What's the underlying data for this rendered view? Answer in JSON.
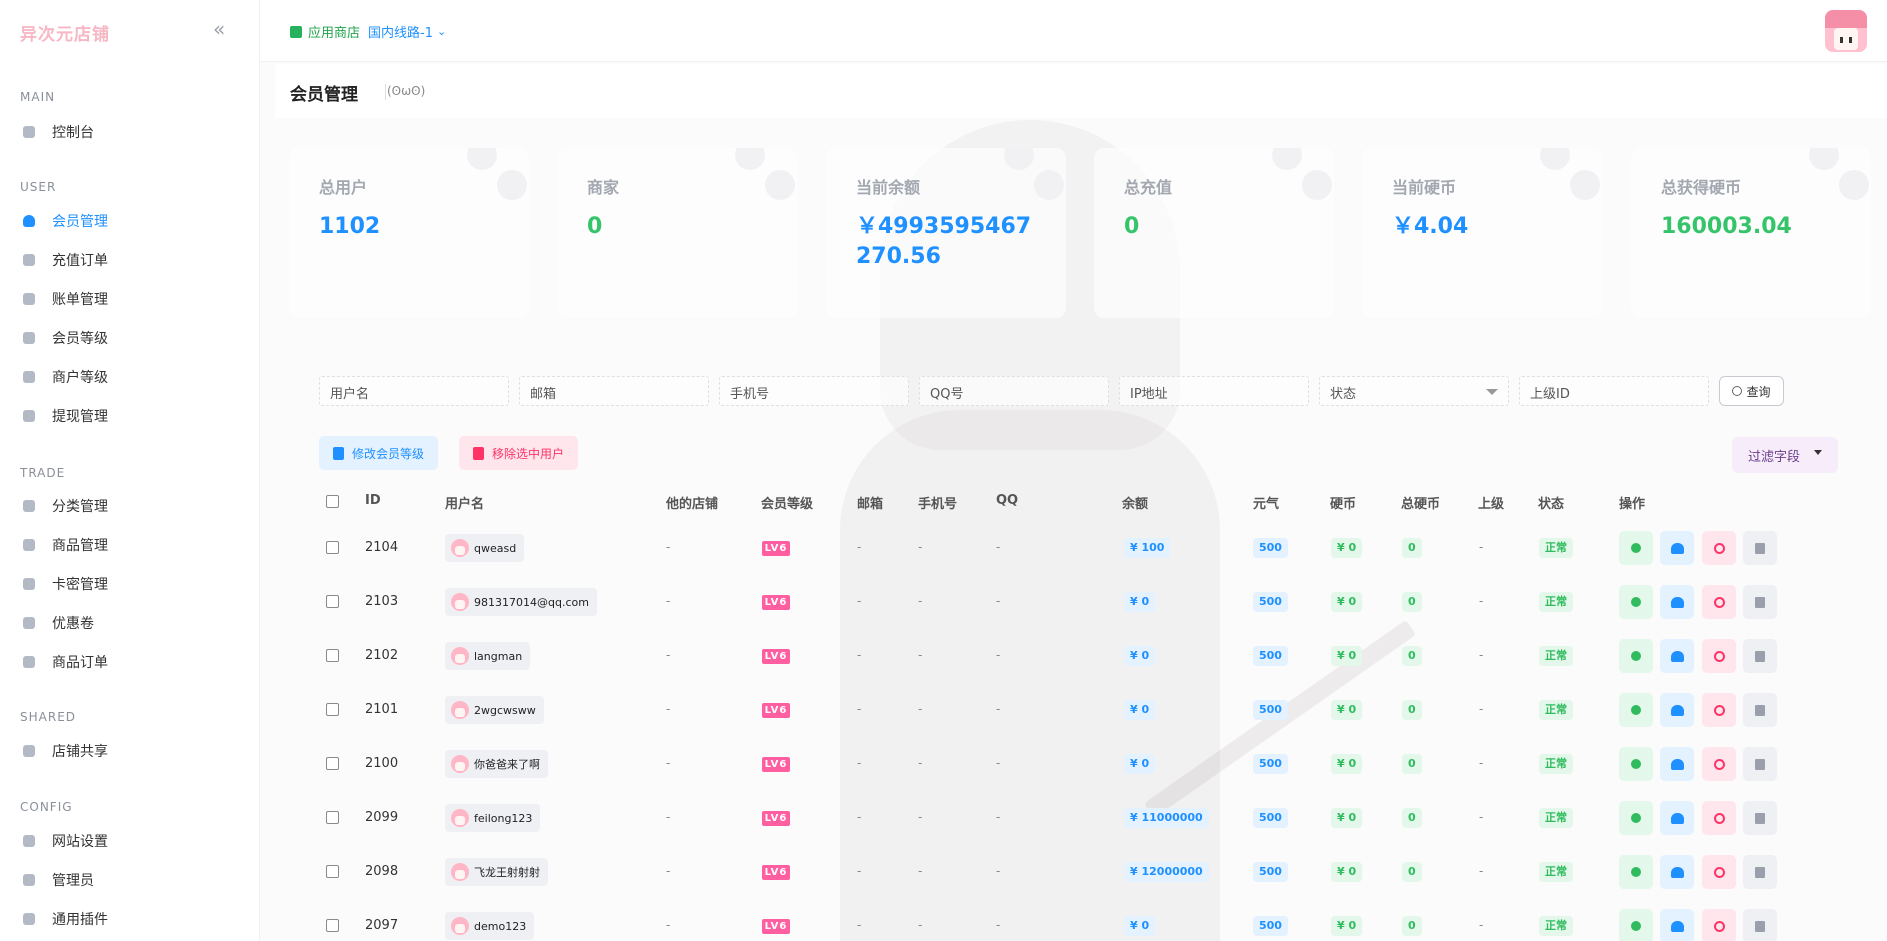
{
  "brand": "异次元店铺",
  "sidebar": {
    "sections": [
      {
        "title": "MAIN",
        "items": [
          {
            "label": "控制台",
            "icon": "dashboard-icon"
          }
        ]
      },
      {
        "title": "USER",
        "items": [
          {
            "label": "会员管理",
            "icon": "user-icon",
            "active": true
          },
          {
            "label": "充值订单",
            "icon": "recharge-icon"
          },
          {
            "label": "账单管理",
            "icon": "bill-icon"
          },
          {
            "label": "会员等级",
            "icon": "level-icon"
          },
          {
            "label": "商户等级",
            "icon": "merchant-level-icon"
          },
          {
            "label": "提现管理",
            "icon": "withdraw-icon"
          }
        ]
      },
      {
        "title": "TRADE",
        "items": [
          {
            "label": "分类管理",
            "icon": "category-icon"
          },
          {
            "label": "商品管理",
            "icon": "goods-icon"
          },
          {
            "label": "卡密管理",
            "icon": "card-icon"
          },
          {
            "label": "优惠卷",
            "icon": "coupon-icon"
          },
          {
            "label": "商品订单",
            "icon": "order-icon"
          }
        ]
      },
      {
        "title": "SHARED",
        "items": [
          {
            "label": "店铺共享",
            "icon": "share-icon"
          }
        ]
      },
      {
        "title": "CONFIG",
        "items": [
          {
            "label": "网站设置",
            "icon": "settings-icon"
          },
          {
            "label": "管理员",
            "icon": "admin-icon"
          },
          {
            "label": "通用插件",
            "icon": "plugin-icon"
          }
        ]
      }
    ]
  },
  "topbar": {
    "store_label": "应用商店",
    "line_label": "国内线路-1"
  },
  "page": {
    "title": "会员管理",
    "kaomoji": "(ʘωʘ)"
  },
  "stats": [
    {
      "label": "总用户",
      "value": "1102",
      "color": "#1e90ff"
    },
    {
      "label": "商家",
      "value": "0",
      "color": "#35c46a"
    },
    {
      "label": "当前余额",
      "value": "￥4993595467270.56",
      "color": "#1e90ff"
    },
    {
      "label": "总充值",
      "value": "0",
      "color": "#35c46a"
    },
    {
      "label": "当前硬币",
      "value": "￥4.04",
      "color": "#1e90ff"
    },
    {
      "label": "总获得硬币",
      "value": "160003.04",
      "color": "#35c46a"
    }
  ],
  "filters": {
    "username": "用户名",
    "email": "邮箱",
    "phone": "手机号",
    "qq": "QQ号",
    "ip": "IP地址",
    "status": "状态",
    "parent_id": "上级ID",
    "query_button": "查询"
  },
  "actions": {
    "modify_level": "修改会员等级",
    "remove_selected": "移除选中用户",
    "filter_fields": "过滤字段"
  },
  "table": {
    "headers": [
      "ID",
      "用户名",
      "他的店铺",
      "会员等级",
      "邮箱",
      "手机号",
      "QQ",
      "余额",
      "元气",
      "硬币",
      "总硬币",
      "上级",
      "状态",
      "操作"
    ],
    "level_badge": "LV6",
    "rows": [
      {
        "id": "2104",
        "username": "qweasd",
        "shop": "-",
        "email": "-",
        "phone": "-",
        "qq": "-",
        "balance": "¥ 100",
        "yuanqi": "500",
        "coin": "¥ 0",
        "total_coin": "0",
        "parent": "-",
        "status": "正常"
      },
      {
        "id": "2103",
        "username": "981317014@qq.com",
        "shop": "-",
        "email": "-",
        "phone": "-",
        "qq": "-",
        "balance": "¥ 0",
        "yuanqi": "500",
        "coin": "¥ 0",
        "total_coin": "0",
        "parent": "-",
        "status": "正常"
      },
      {
        "id": "2102",
        "username": "langman",
        "shop": "-",
        "email": "-",
        "phone": "-",
        "qq": "-",
        "balance": "¥ 0",
        "yuanqi": "500",
        "coin": "¥ 0",
        "total_coin": "0",
        "parent": "-",
        "status": "正常"
      },
      {
        "id": "2101",
        "username": "2wgcwsww",
        "shop": "-",
        "email": "-",
        "phone": "-",
        "qq": "-",
        "balance": "¥ 0",
        "yuanqi": "500",
        "coin": "¥ 0",
        "total_coin": "0",
        "parent": "-",
        "status": "正常"
      },
      {
        "id": "2100",
        "username": "你爸爸来了啊",
        "shop": "-",
        "email": "-",
        "phone": "-",
        "qq": "-",
        "balance": "¥ 0",
        "yuanqi": "500",
        "coin": "¥ 0",
        "total_coin": "0",
        "parent": "-",
        "status": "正常"
      },
      {
        "id": "2099",
        "username": "feilong123",
        "shop": "-",
        "email": "-",
        "phone": "-",
        "qq": "-",
        "balance": "¥ 11000000",
        "yuanqi": "500",
        "coin": "¥ 0",
        "total_coin": "0",
        "parent": "-",
        "status": "正常"
      },
      {
        "id": "2098",
        "username": "飞龙王射射射",
        "shop": "-",
        "email": "-",
        "phone": "-",
        "qq": "-",
        "balance": "¥ 12000000",
        "yuanqi": "500",
        "coin": "¥ 0",
        "total_coin": "0",
        "parent": "-",
        "status": "正常"
      },
      {
        "id": "2097",
        "username": "demo123",
        "shop": "-",
        "email": "-",
        "phone": "-",
        "qq": "-",
        "balance": "¥ 0",
        "yuanqi": "500",
        "coin": "¥ 0",
        "total_coin": "0",
        "parent": "-",
        "status": "正常"
      }
    ]
  },
  "colors": {
    "accent": "#1e90ff",
    "success": "#35c46a",
    "danger": "#ff3366",
    "brand_pink": "#f7b7c4"
  }
}
